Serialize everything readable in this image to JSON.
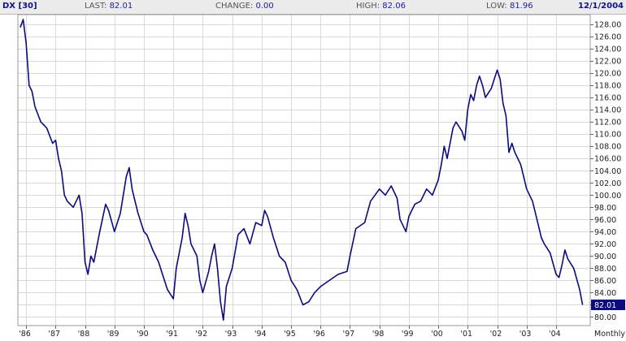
{
  "header": {
    "symbol": "DX [30]",
    "last_label": "LAST:",
    "last_value": "82.01",
    "change_label": "CHANGE:",
    "change_value": "0.00",
    "high_label": "HIGH:",
    "high_value": "82.06",
    "low_label": "LOW:",
    "low_value": "81.96",
    "date": "12/1/2004"
  },
  "chart_data": {
    "type": "line",
    "title": "",
    "xlabel": "",
    "ylabel": "",
    "period": "Monthly",
    "last_value_label": "82.01",
    "ylim": [
      78.6,
      129.6
    ],
    "y_ticks": [
      80,
      82,
      84,
      86,
      88,
      90,
      92,
      94,
      96,
      98,
      100,
      102,
      104,
      106,
      108,
      110,
      112,
      114,
      116,
      118,
      120,
      122,
      124,
      126,
      128
    ],
    "y_tick_labels": [
      "80.00",
      "82.00",
      "84.00",
      "86.00",
      "88.00",
      "90.00",
      "92.00",
      "94.00",
      "96.00",
      "98.00",
      "100.00",
      "102.00",
      "104.00",
      "106.00",
      "108.00",
      "110.00",
      "112.00",
      "114.00",
      "116.00",
      "118.00",
      "120.00",
      "122.00",
      "124.00",
      "126.00",
      "128.00"
    ],
    "xlim": [
      1985.72,
      2005.16
    ],
    "x_ticks": [
      1986,
      1987,
      1988,
      1989,
      1990,
      1991,
      1992,
      1993,
      1994,
      1995,
      1996,
      1997,
      1998,
      1999,
      2000,
      2001,
      2002,
      2003,
      2004
    ],
    "x_tick_labels": [
      "'86",
      "'87",
      "'88",
      "'89",
      "'90",
      "'91",
      "'92",
      "'93",
      "'94",
      "'95",
      "'96",
      "'97",
      "'98",
      "'99",
      "'00",
      "'01",
      "'02",
      "'03",
      "'04"
    ],
    "grid": true,
    "colors": {
      "line": "#0b0b7c",
      "grid": "#d8d8d8",
      "badge": "#0b0b7c"
    },
    "series": [
      {
        "x": [
          1985.8,
          1985.9,
          1986.0,
          1986.1,
          1986.2,
          1986.3,
          1986.5,
          1986.7,
          1986.9,
          1987.0,
          1987.1,
          1987.2,
          1987.3,
          1987.4,
          1987.6,
          1987.8,
          1987.9,
          1988.0,
          1988.1,
          1988.2,
          1988.3,
          1988.5,
          1988.7,
          1988.8,
          1989.0,
          1989.2,
          1989.4,
          1989.5,
          1989.6,
          1989.7,
          1989.8,
          1990.0,
          1990.1,
          1990.3,
          1990.5,
          1990.7,
          1990.8,
          1991.0,
          1991.1,
          1991.3,
          1991.4,
          1991.5,
          1991.6,
          1991.8,
          1991.9,
          1992.0,
          1992.2,
          1992.3,
          1992.4,
          1992.5,
          1992.6,
          1992.7,
          1992.8,
          1993.0,
          1993.2,
          1993.4,
          1993.6,
          1993.8,
          1994.0,
          1994.1,
          1994.2,
          1994.4,
          1994.6,
          1994.8,
          1995.0,
          1995.2,
          1995.4,
          1995.6,
          1995.8,
          1996.0,
          1996.3,
          1996.6,
          1996.9,
          1997.0,
          1997.2,
          1997.5,
          1997.7,
          1998.0,
          1998.2,
          1998.4,
          1998.6,
          1998.7,
          1998.9,
          1999.0,
          1999.2,
          1999.4,
          1999.6,
          1999.8,
          2000.0,
          2000.1,
          2000.2,
          2000.3,
          2000.4,
          2000.5,
          2000.6,
          2000.8,
          2000.9,
          2001.0,
          2001.1,
          2001.2,
          2001.3,
          2001.4,
          2001.5,
          2001.6,
          2001.8,
          2001.9,
          2002.0,
          2002.1,
          2002.2,
          2002.3,
          2002.4,
          2002.5,
          2002.6,
          2002.8,
          2003.0,
          2003.2,
          2003.4,
          2003.5,
          2003.6,
          2003.8,
          2004.0,
          2004.1,
          2004.2,
          2004.3,
          2004.4,
          2004.6,
          2004.8,
          2004.9
        ],
        "values": [
          127.5,
          128.8,
          125.0,
          118.0,
          117.0,
          114.5,
          112.0,
          111.0,
          108.5,
          109.0,
          106.0,
          104.0,
          100.0,
          99.0,
          98.0,
          100.0,
          97.0,
          89.0,
          87.0,
          90.0,
          89.0,
          94.0,
          98.5,
          97.5,
          94.0,
          97.0,
          103.0,
          104.5,
          101.0,
          99.0,
          97.0,
          94.0,
          93.5,
          91.0,
          89.0,
          86.0,
          84.5,
          83.0,
          88.0,
          93.0,
          97.0,
          95.0,
          92.0,
          90.0,
          86.0,
          84.0,
          87.5,
          90.0,
          92.0,
          88.0,
          82.5,
          79.5,
          85.0,
          88.0,
          93.5,
          94.5,
          92.0,
          95.5,
          95.0,
          97.5,
          96.5,
          93.0,
          90.0,
          89.0,
          86.0,
          84.5,
          82.0,
          82.5,
          84.0,
          85.0,
          86.0,
          87.0,
          87.5,
          90.0,
          94.5,
          95.5,
          99.0,
          101.0,
          100.0,
          101.5,
          99.5,
          96.0,
          94.0,
          96.5,
          98.5,
          99.0,
          101.0,
          100.0,
          102.5,
          105.0,
          108.0,
          106.0,
          108.5,
          111.0,
          112.0,
          110.5,
          109.0,
          114.0,
          116.5,
          115.5,
          118.0,
          119.5,
          118.0,
          116.0,
          117.5,
          119.0,
          120.5,
          119.0,
          115.0,
          113.0,
          107.0,
          108.5,
          107.0,
          105.0,
          101.0,
          99.0,
          95.0,
          93.0,
          92.0,
          90.5,
          87.0,
          86.5,
          88.5,
          91.0,
          89.5,
          88.0,
          84.5,
          82.0
        ]
      }
    ]
  }
}
